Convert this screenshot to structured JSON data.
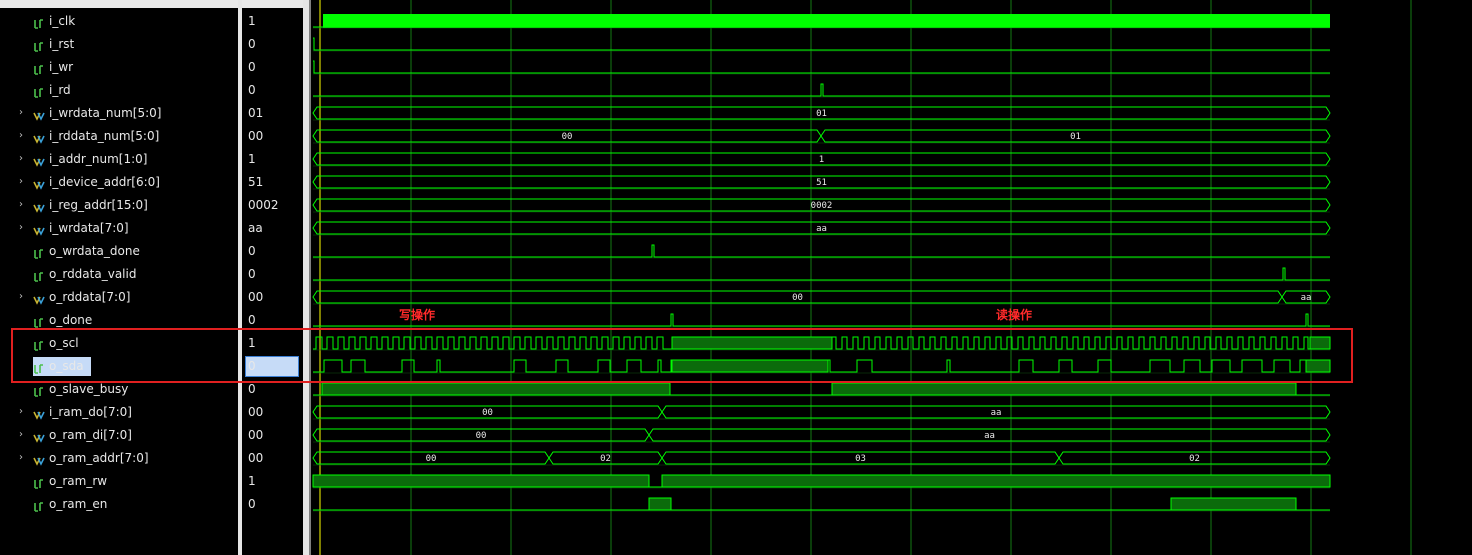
{
  "signals": [
    {
      "id": "i_clk",
      "name": "i_clk",
      "value": "1",
      "type": "bit",
      "expandable": false
    },
    {
      "id": "i_rst",
      "name": "i_rst",
      "value": "0",
      "type": "bit",
      "expandable": false
    },
    {
      "id": "i_wr",
      "name": "i_wr",
      "value": "0",
      "type": "bit",
      "expandable": false
    },
    {
      "id": "i_rd",
      "name": "i_rd",
      "value": "0",
      "type": "bit",
      "expandable": false
    },
    {
      "id": "i_wrdata_num",
      "name": "i_wrdata_num[5:0]",
      "value": "01",
      "type": "bus",
      "expandable": true
    },
    {
      "id": "i_rddata_num",
      "name": "i_rddata_num[5:0]",
      "value": "00",
      "type": "bus",
      "expandable": true
    },
    {
      "id": "i_addr_num",
      "name": "i_addr_num[1:0]",
      "value": "1",
      "type": "bus",
      "expandable": true
    },
    {
      "id": "i_device_addr",
      "name": "i_device_addr[6:0]",
      "value": "51",
      "type": "bus",
      "expandable": true
    },
    {
      "id": "i_reg_addr",
      "name": "i_reg_addr[15:0]",
      "value": "0002",
      "type": "bus",
      "expandable": true
    },
    {
      "id": "i_wrdata",
      "name": "i_wrdata[7:0]",
      "value": "aa",
      "type": "bus",
      "expandable": true
    },
    {
      "id": "o_wrdata_done",
      "name": "o_wrdata_done",
      "value": "0",
      "type": "bit",
      "expandable": false
    },
    {
      "id": "o_rddata_valid",
      "name": "o_rddata_valid",
      "value": "0",
      "type": "bit",
      "expandable": false
    },
    {
      "id": "o_rddata",
      "name": "o_rddata[7:0]",
      "value": "00",
      "type": "bus",
      "expandable": true
    },
    {
      "id": "o_done",
      "name": "o_done",
      "value": "0",
      "type": "bit",
      "expandable": false
    },
    {
      "id": "o_scl",
      "name": "o_scl",
      "value": "1",
      "type": "bit",
      "expandable": false
    },
    {
      "id": "o_sda",
      "name": "o_sda",
      "value": "0",
      "type": "bit",
      "expandable": false
    },
    {
      "id": "o_slave_busy",
      "name": "o_slave_busy",
      "value": "0",
      "type": "bit",
      "expandable": false
    },
    {
      "id": "i_ram_do",
      "name": "i_ram_do[7:0]",
      "value": "00",
      "type": "bus",
      "expandable": true
    },
    {
      "id": "o_ram_di",
      "name": "o_ram_di[7:0]",
      "value": "00",
      "type": "bus",
      "expandable": true
    },
    {
      "id": "o_ram_addr",
      "name": "o_ram_addr[7:0]",
      "value": "00",
      "type": "bus",
      "expandable": true
    },
    {
      "id": "o_ram_rw",
      "name": "o_ram_rw",
      "value": "1",
      "type": "bit",
      "expandable": false
    },
    {
      "id": "o_ram_en",
      "name": "o_ram_en",
      "value": "0",
      "type": "bit",
      "expandable": false
    }
  ],
  "bus_labels": {
    "i_wrdata_num": [
      "01"
    ],
    "i_rddata_num": [
      "00",
      "01"
    ],
    "i_addr_num": [
      "1"
    ],
    "i_device_addr": [
      "51"
    ],
    "i_reg_addr": [
      "0002"
    ],
    "i_wrdata": [
      "aa"
    ],
    "o_rddata": [
      "00",
      "aa"
    ],
    "i_ram_do": [
      "00",
      "aa"
    ],
    "o_ram_di": [
      "00",
      "aa"
    ],
    "o_ram_addr": [
      "00",
      "02",
      "03",
      "02"
    ]
  },
  "annotations": {
    "write_op": "写操作",
    "read_op": "读操作"
  },
  "selected_signal": "o_sda",
  "colors": {
    "wave": "#00ff00",
    "grid": "#1fa61f",
    "fill": "#0b6b0b",
    "cursor": "#ffff00",
    "highlight_box": "#e02020",
    "annotation": "#ff2a2a"
  }
}
